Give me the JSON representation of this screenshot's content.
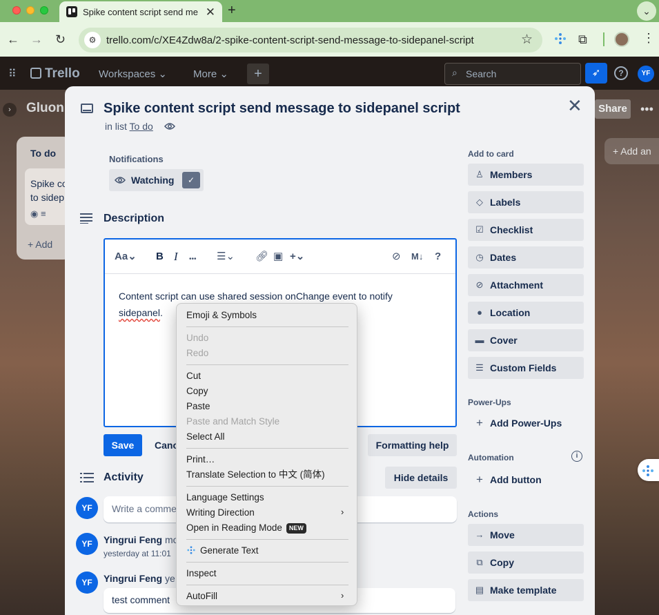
{
  "browser": {
    "tab_title": "Spike content script send me",
    "tab_close": "✕",
    "new_tab": "+",
    "url": "trello.com/c/XE4Zdw8a/2-spike-content-script-send-message-to-sidepanel-script"
  },
  "trello_nav": {
    "logo": "Trello",
    "workspaces": "Workspaces",
    "more": "More",
    "create": "+",
    "search_placeholder": "Search",
    "avatar": "YF"
  },
  "board": {
    "name": "Gluon",
    "share": "Share",
    "list_title": "To do",
    "card_preview": "Spike co\nto sidep",
    "card_preview_line1": "Spike co",
    "card_preview_line2": "to sidep",
    "add_card": "Add",
    "add_another": "Add an"
  },
  "card": {
    "title": "Spike content script send message to sidepanel script",
    "in_list_prefix": "in list",
    "list_name": "To do",
    "notifications_label": "Notifications",
    "watching_label": "Watching",
    "description_title": "Description",
    "description_line1": "Content script can use shared session onChange event to notify",
    "description_line2": "sidepanel",
    "description_period": ".",
    "save": "Save",
    "cancel": "Canc",
    "formatting_help": "Formatting help",
    "activity_title": "Activity",
    "hide_details": "Hide details",
    "comment_placeholder": "Write a comme",
    "comment_avatar": "YF",
    "activity": [
      {
        "avatar": "YF",
        "name": "Yingrui Feng",
        "rest": "mo",
        "time": "yesterday at 11:01"
      },
      {
        "avatar": "YF",
        "name": "Yingrui Feng",
        "rest": "ye",
        "comment": "test comment"
      }
    ]
  },
  "editor_toolbar": {
    "text_style": "Aa",
    "bold": "B",
    "italic": "I",
    "more": "•••",
    "markdown": "M↓",
    "help": "?"
  },
  "sidebar": {
    "add_to_card_label": "Add to card",
    "add_to_card": [
      {
        "label": "Members",
        "icon": "person-icon"
      },
      {
        "label": "Labels",
        "icon": "tag-icon"
      },
      {
        "label": "Checklist",
        "icon": "checkbox-icon"
      },
      {
        "label": "Dates",
        "icon": "clock-icon"
      },
      {
        "label": "Attachment",
        "icon": "paperclip-icon"
      },
      {
        "label": "Location",
        "icon": "pin-icon"
      },
      {
        "label": "Cover",
        "icon": "cover-icon"
      },
      {
        "label": "Custom Fields",
        "icon": "fields-icon"
      }
    ],
    "powerups_label": "Power-Ups",
    "add_powerups": "Add Power-Ups",
    "automation_label": "Automation",
    "add_button": "Add button",
    "actions_label": "Actions",
    "actions": [
      {
        "label": "Move",
        "icon": "arrow-right-icon"
      },
      {
        "label": "Copy",
        "icon": "copy-icon"
      },
      {
        "label": "Make template",
        "icon": "template-icon"
      }
    ]
  },
  "context_menu": {
    "items": [
      {
        "label": "Emoji & Symbols",
        "enabled": true
      },
      {
        "label": "Undo",
        "enabled": false
      },
      {
        "label": "Redo",
        "enabled": false
      },
      {
        "label": "Cut",
        "enabled": true
      },
      {
        "label": "Copy",
        "enabled": true
      },
      {
        "label": "Paste",
        "enabled": true
      },
      {
        "label": "Paste and Match Style",
        "enabled": false
      },
      {
        "label": "Select All",
        "enabled": true
      },
      {
        "label": "Print…",
        "enabled": true
      },
      {
        "label": "Translate Selection to 中文 (简体)",
        "enabled": true
      },
      {
        "label": "Language Settings",
        "enabled": true
      },
      {
        "label": "Writing Direction",
        "enabled": true,
        "submenu": true
      },
      {
        "label": "Open in Reading Mode",
        "enabled": true,
        "badge": "NEW"
      },
      {
        "label": "Generate Text",
        "enabled": true
      },
      {
        "label": "Inspect",
        "enabled": true
      },
      {
        "label": "AutoFill",
        "enabled": true,
        "submenu": true
      }
    ]
  },
  "colors": {
    "tab_strip": "#7fb86f",
    "toolbar": "#e9f5e3",
    "trello_blue": "#0c66e4",
    "modal_bg": "#f1f2f4"
  }
}
